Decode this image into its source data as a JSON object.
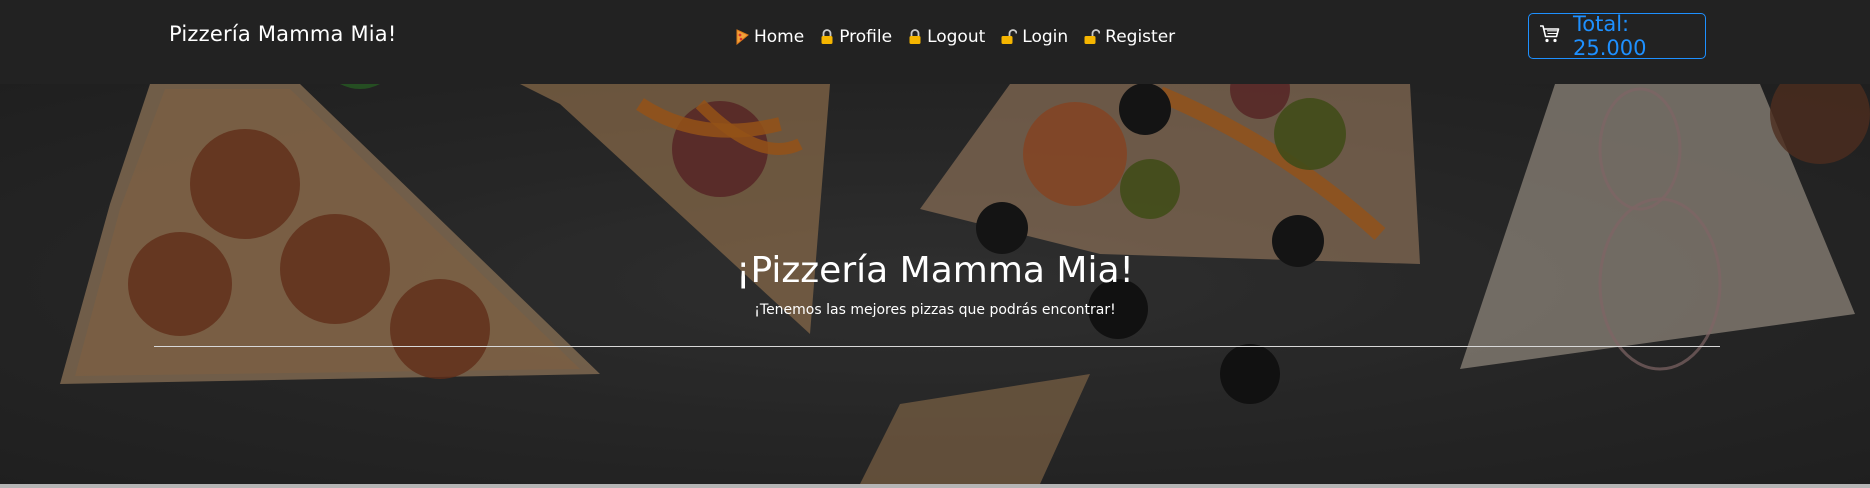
{
  "navbar": {
    "brand": "Pizzería Mamma Mia!",
    "links": [
      {
        "label": "Home",
        "icon": "pizza-icon"
      },
      {
        "label": "Profile",
        "icon": "lock-icon"
      },
      {
        "label": "Logout",
        "icon": "lock-icon"
      },
      {
        "label": "Login",
        "icon": "unlock-icon"
      },
      {
        "label": "Register",
        "icon": "unlock-icon"
      }
    ],
    "cart": {
      "label": "Total: 25.000",
      "icon": "cart-icon",
      "color": "#1e90ff"
    }
  },
  "hero": {
    "title": "¡Pizzería Mamma Mia!",
    "subtitle": "¡Tenemos las mejores pizzas que podrás encontrar!"
  },
  "colors": {
    "navbar_bg": "#222222",
    "accent": "#1e90ff",
    "lock_gold": "#f5b500"
  }
}
